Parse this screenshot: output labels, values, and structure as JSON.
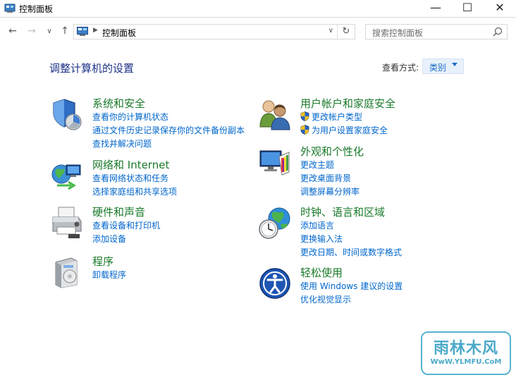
{
  "window": {
    "title": "控制面板",
    "controls": {
      "minimize": "—",
      "maximize": "☐",
      "close": "✕"
    }
  },
  "nav": {
    "back_icon": "arrow-left-icon",
    "forward_icon": "arrow-right-icon",
    "recent_icon": "chevron-down-icon",
    "up_icon": "arrow-up-icon",
    "back": "←",
    "forward": "→",
    "recent": "∨",
    "up": "↑"
  },
  "address": {
    "separator": "▶",
    "crumb": "控制面板",
    "dropdown": "∨",
    "refresh": "↻"
  },
  "search": {
    "placeholder": "搜索控制面板",
    "icon": "search-icon"
  },
  "main": {
    "heading": "调整计算机的设置",
    "view_by_label": "查看方式:",
    "view_by_value": "类别"
  },
  "categories": [
    {
      "title": "系统和安全",
      "icon": "shield-security-icon",
      "links": [
        "查看你的计算机状态",
        "通过文件历史记录保存你的文件备份副本",
        "查找并解决问题"
      ]
    },
    {
      "title": "网络和 Internet",
      "icon": "network-globe-icon",
      "links": [
        "查看网络状态和任务",
        "选择家庭组和共享选项"
      ]
    },
    {
      "title": "硬件和声音",
      "icon": "printer-hardware-icon",
      "links": [
        "查看设备和打印机",
        "添加设备"
      ]
    },
    {
      "title": "程序",
      "icon": "program-box-icon",
      "links": [
        "卸载程序"
      ]
    },
    {
      "title": "用户帐户和家庭安全",
      "icon": "users-icon",
      "links": [
        "更改帐户类型",
        "为用户设置家庭安全"
      ]
    },
    {
      "title": "外观和个性化",
      "icon": "monitor-palette-icon",
      "links": [
        "更改主题",
        "更改桌面背景",
        "调整屏幕分辨率"
      ]
    },
    {
      "title": "时钟、语言和区域",
      "icon": "clock-globe-icon",
      "links": [
        "添加语言",
        "更换输入法",
        "更改日期、时间或数字格式"
      ]
    },
    {
      "title": "轻松使用",
      "icon": "ease-of-access-icon",
      "links": [
        "使用 Windows 建议的设置",
        "优化视觉显示"
      ]
    }
  ],
  "watermark": {
    "line1": "雨林木风",
    "line2": "WwW.YLMFU.CoM"
  },
  "colors": {
    "category_title": "#1a7a2a",
    "link": "#0066cc",
    "heading": "#1e3287",
    "view_select_bg": "#e8f1fb"
  }
}
